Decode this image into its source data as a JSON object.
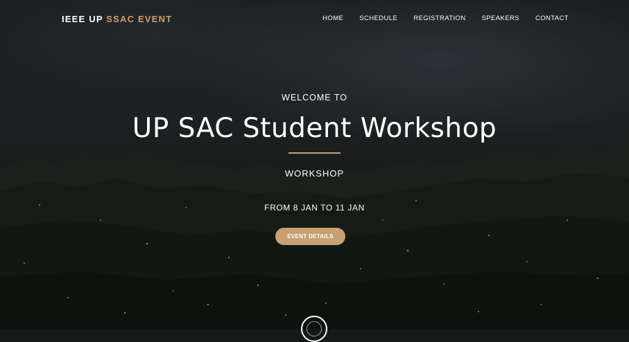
{
  "brand": {
    "prefix": "IEEE UP",
    "accent": "SSAC EVENT",
    "accent_color": "#c9a072"
  },
  "nav": {
    "items": [
      {
        "label": "HOME"
      },
      {
        "label": "SCHEDULE"
      },
      {
        "label": "REGISTRATION"
      },
      {
        "label": "SPEAKERS"
      },
      {
        "label": "CONTACT"
      }
    ]
  },
  "hero": {
    "welcome": "WELCOME TO",
    "title": "UP SAC Student Workshop",
    "subtitle": "WORKSHOP",
    "dates": "FROM 8 JAN TO 11 JAN",
    "button_label": "EVENT DETAILS",
    "background_icon": "mountain-landscape-image",
    "scroll_icon": "scroll-down-icon"
  }
}
